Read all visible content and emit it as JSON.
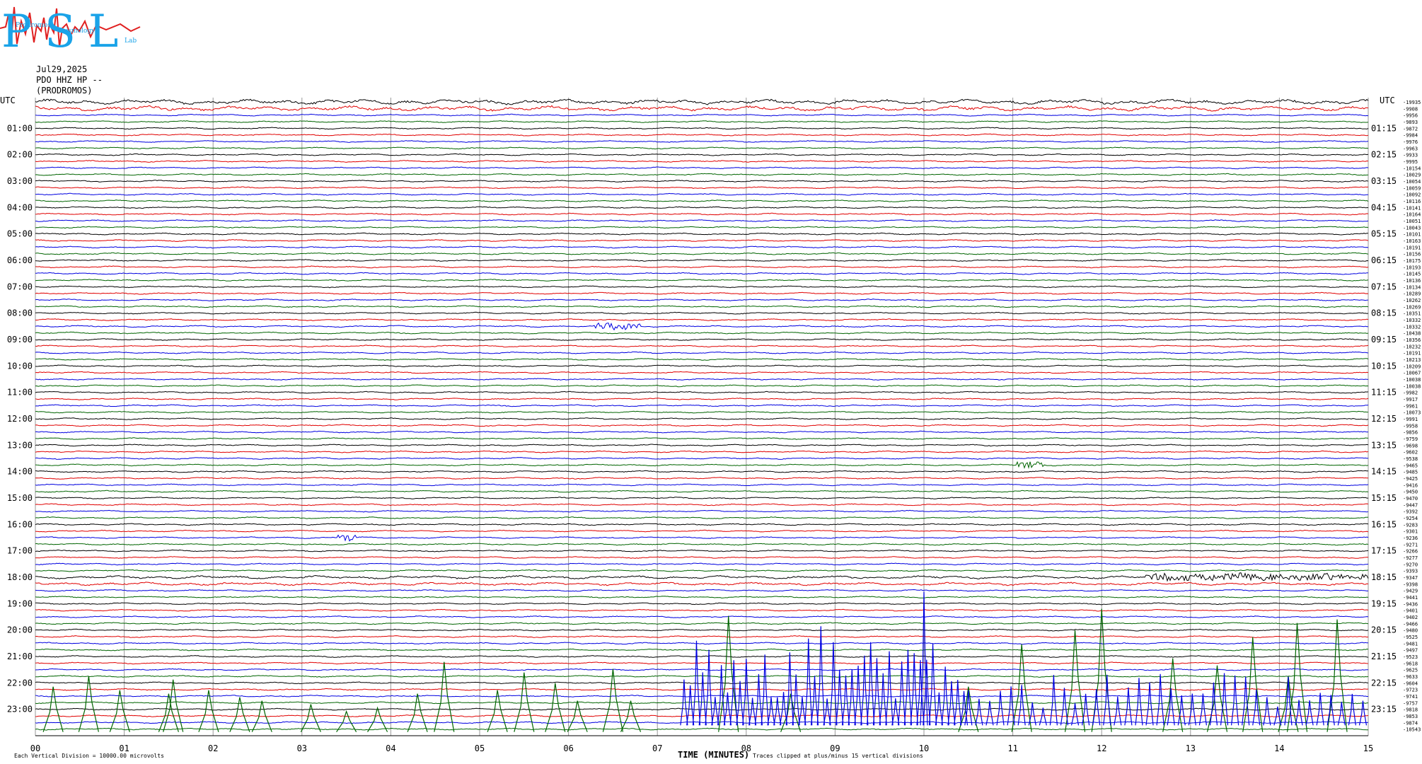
{
  "header": {
    "logo_text": "PSL",
    "logo_subtitle_a": "Prodromos",
    "logo_subtitle_b": "Seismology",
    "logo_subtitle_c": "Lab",
    "date": "Jul29,2025",
    "station": "PDO HHZ HP --",
    "location": "(PRODROMOS)"
  },
  "colors": {
    "trace_cycle": [
      "#000000",
      "#e00000",
      "#0000e0",
      "#006400"
    ],
    "grid": "#9a9a9a",
    "logo_blue": "#1aa3e8",
    "logo_red": "#e02020"
  },
  "chart_data": {
    "type": "line",
    "title": "",
    "xlabel": "TIME (MINUTES)",
    "ylabel": "UTC",
    "right_ylabel": "UTC",
    "xlim": [
      0,
      15
    ],
    "x_ticks": [
      "00",
      "01",
      "02",
      "03",
      "04",
      "05",
      "06",
      "07",
      "08",
      "09",
      "10",
      "11",
      "12",
      "13",
      "14",
      "15"
    ],
    "rows_per_hour": 4,
    "row_count": 96,
    "left_hour_labels": [
      "01:00",
      "02:00",
      "03:00",
      "04:00",
      "05:00",
      "06:00",
      "07:00",
      "08:00",
      "09:00",
      "10:00",
      "11:00",
      "12:00",
      "13:00",
      "14:00",
      "15:00",
      "16:00",
      "17:00",
      "18:00",
      "19:00",
      "20:00",
      "21:00",
      "22:00",
      "23:00"
    ],
    "right_hour_labels": [
      "01:15",
      "02:15",
      "03:15",
      "04:15",
      "05:15",
      "06:15",
      "07:15",
      "08:15",
      "09:15",
      "10:15",
      "11:15",
      "12:15",
      "13:15",
      "14:15",
      "15:15",
      "16:15",
      "17:15",
      "18:15",
      "19:15",
      "20:15",
      "21:15",
      "22:15",
      "23:15"
    ],
    "row_offsets": [
      "-19935",
      "-9908",
      "-9956",
      "-9893",
      "-9872",
      "-9984",
      "-9976",
      "-9963",
      "-9933",
      "-9995",
      "-10154",
      "-10029",
      "-10054",
      "-10059",
      "-10092",
      "-10116",
      "-10141",
      "-10164",
      "-10051",
      "-10043",
      "-10101",
      "-10163",
      "-10191",
      "-10156",
      "-10175",
      "-10193",
      "-10145",
      "-10136",
      "-10134",
      "-10289",
      "-10262",
      "-10269",
      "-10351",
      "-10332",
      "-10332",
      "-10438",
      "-10356",
      "-10232",
      "-10191",
      "-10213",
      "-10209",
      "-10067",
      "-10038",
      "-10038",
      "-9982",
      "-9917",
      "-9961",
      "-10073",
      "-9991",
      "-9958",
      "-9856",
      "-9759",
      "-9698",
      "-9602",
      "-9538",
      "-9465",
      "-9485",
      "-9425",
      "-9416",
      "-9450",
      "-9470",
      "-9447",
      "-9392",
      "-9254",
      "-9283",
      "-9301",
      "-9236",
      "-9271",
      "-9266",
      "-9277",
      "-9270",
      "-9393",
      "-9347",
      "-9398",
      "-9429",
      "-9441",
      "-9436",
      "-9401",
      "-9402",
      "-9466",
      "-9480",
      "-9525",
      "-9481",
      "-9497",
      "-9523",
      "-9618",
      "-9625",
      "-9633",
      "-9604",
      "-9723",
      "-9741",
      "-9757",
      "-9818",
      "-9853",
      "-9874",
      "-10543"
    ],
    "events": [
      {
        "row": 72,
        "minute_start": 12.5,
        "minute_end": 15.0,
        "note": "broadband noise"
      },
      {
        "row": 55,
        "minute_start": 11.05,
        "minute_end": 11.35,
        "note": "small burst"
      },
      {
        "row": 66,
        "minute_start": 3.4,
        "minute_end": 3.6,
        "note": "small burst"
      },
      {
        "row": 34,
        "minute_start": 6.3,
        "minute_end": 6.8,
        "note": "small burst"
      }
    ],
    "grid": true,
    "footer_scale": "Each Vertical Division = 10000.00 microvolts",
    "footer_clip": "Traces clipped at plus/minus 15 vertical divisions"
  }
}
